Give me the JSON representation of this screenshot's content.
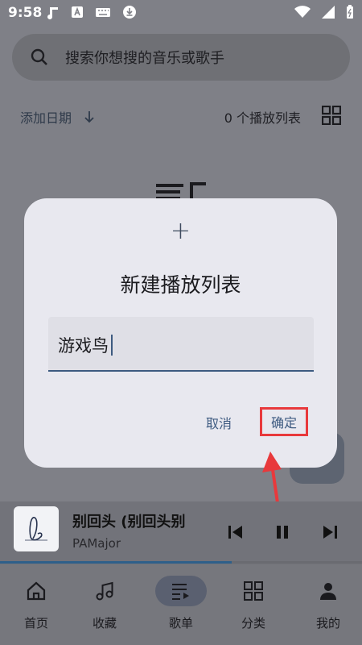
{
  "status_bar": {
    "time": "9:58"
  },
  "search": {
    "placeholder": "搜索你想搜的音乐或歌手"
  },
  "list_header": {
    "sort_label": "添加日期",
    "count_label": "0 个播放列表"
  },
  "dialog": {
    "title": "新建播放列表",
    "input_value": "游戏鸟",
    "cancel_label": "取消",
    "confirm_label": "确定"
  },
  "now_playing": {
    "title": "别回头 (别回头别",
    "artist": "PAMajor",
    "progress": 0.64
  },
  "bottom_nav": {
    "items": [
      {
        "label": "首页",
        "icon": "home-icon"
      },
      {
        "label": "收藏",
        "icon": "music-note-icon"
      },
      {
        "label": "歌单",
        "icon": "playlist-icon",
        "active": true
      },
      {
        "label": "分类",
        "icon": "grid-icon"
      },
      {
        "label": "我的",
        "icon": "person-icon"
      }
    ]
  },
  "colors": {
    "accent": "#3d5a80",
    "highlight_box": "#e8393c",
    "dialog_bg": "#e8e8ef",
    "scrim": "#7f8087"
  }
}
